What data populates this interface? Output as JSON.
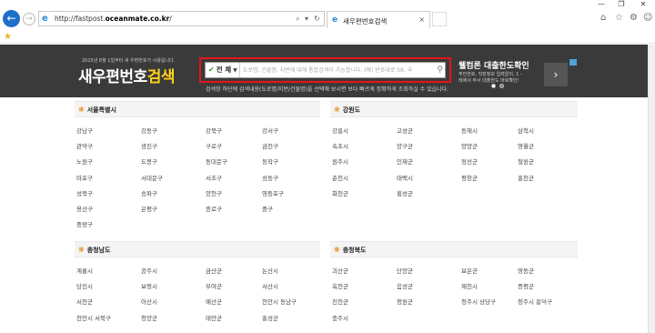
{
  "browser": {
    "url_prefix": "http://fastpost.",
    "url_domain": "oceanmate.co.kr",
    "url_suffix": "/",
    "search_ctl": "⌕",
    "dropdown_ctl": "▾",
    "refresh_ctl": "↻",
    "tab_title": "새우편번호검색",
    "tab_close": "×",
    "window_minimize": "—",
    "window_maximize": "❐",
    "window_close": "✕",
    "icons": [
      "back-arrow-icon",
      "forward-arrow-icon",
      "ie-logo-icon",
      "home-icon",
      "star-icon",
      "gear-icon",
      "smiley-icon"
    ]
  },
  "header": {
    "notice": "2015년 8월 1일부터 새 우편번호가 사용됩니다.",
    "logo_part1": "새우편번호",
    "logo_part2": "검색",
    "search_scope": "전 체",
    "search_placeholder": "도로명, 건물명, 지번에 대해 통합검색이 가능합니다. (예) 반포대로 58, 국",
    "sub_notice": "검색창 하단에 검색내용(도로명/지번/건물명)을 선택해 보시면 보다 빠르게 정확하게 조회하실 수 있습니다.",
    "accent_red": "#e8141b",
    "logo_yellow": "#ffd21a"
  },
  "ad": {
    "title": "웰컴론 대출한도확인",
    "line1": "주민번호, 직장정보 입력없이, 1 -",
    "line2": "레에서 무서 대출한도 바로확인!",
    "arrow": "›"
  },
  "regions": [
    {
      "name": "서울특별시",
      "cities": [
        "강남구",
        "강동구",
        "강북구",
        "강서구",
        "관악구",
        "광진구",
        "구로구",
        "금천구",
        "노원구",
        "도봉구",
        "동대문구",
        "동작구",
        "마포구",
        "서대문구",
        "서초구",
        "성동구",
        "성북구",
        "송파구",
        "양천구",
        "영등포구",
        "용산구",
        "은평구",
        "종로구",
        "중구",
        "중랑구"
      ]
    },
    {
      "name": "강원도",
      "cities": [
        "강릉시",
        "고성군",
        "동해시",
        "삼척시",
        "속초시",
        "양구군",
        "양양군",
        "영월군",
        "원주시",
        "인제군",
        "정선군",
        "철원군",
        "춘천시",
        "태백시",
        "평창군",
        "홍천군",
        "화천군",
        "횡성군"
      ]
    },
    {
      "name": "충청남도",
      "cities": [
        "계룡시",
        "공주시",
        "금산군",
        "논산시",
        "당진시",
        "보령시",
        "부여군",
        "서산시",
        "서천군",
        "아산시",
        "예산군",
        "천안시 동남구",
        "천안시 서북구",
        "청양군",
        "태안군",
        "홍성군"
      ]
    },
    {
      "name": "충청북도",
      "cities": [
        "괴산군",
        "단양군",
        "보은군",
        "영동군",
        "옥천군",
        "음성군",
        "제천시",
        "증평군",
        "진천군",
        "청원군",
        "청주시 상당구",
        "청주시 흥덕구",
        "충주시"
      ]
    }
  ]
}
